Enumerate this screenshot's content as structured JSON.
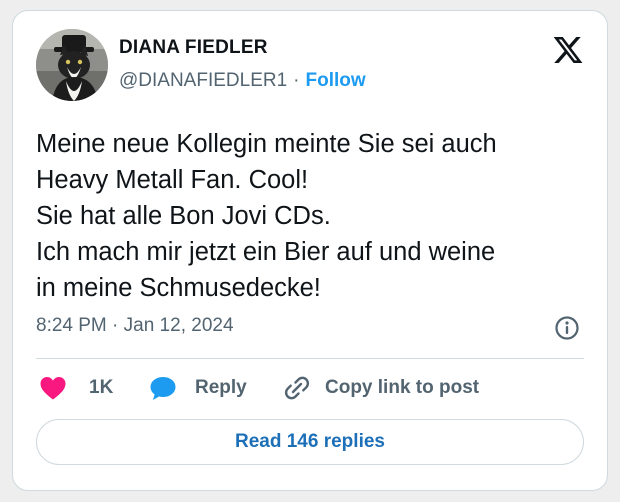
{
  "author": {
    "name": "DIANA FIEDLER",
    "handle": "@DIANAFIEDLER1",
    "separator": "·",
    "follow_label": "Follow"
  },
  "tweet": {
    "lines": [
      "Meine neue Kollegin meinte Sie sei auch",
      "Heavy Metall Fan. Cool!",
      "Sie hat alle Bon Jovi CDs.",
      "Ich mach mir jetzt ein Bier auf und weine",
      "in meine Schmusedecke!"
    ],
    "timestamp": "8:24 PM · Jan 12, 2024"
  },
  "actions": {
    "like_count": "1K",
    "reply_label": "Reply",
    "copy_label": "Copy link to post"
  },
  "footer": {
    "read_replies_label": "Read 146 replies"
  },
  "icons": {
    "logo": "x-logo-icon",
    "info": "info-icon",
    "like": "heart-icon",
    "reply": "speech-bubble-icon",
    "copy": "link-icon"
  },
  "colors": {
    "follow": "#1d9bf0",
    "heart": "#f91880",
    "reply_bubble": "#1d9bf0",
    "read_replies": "#1d70b8",
    "muted_text": "#536471",
    "border": "#cfd9de"
  }
}
